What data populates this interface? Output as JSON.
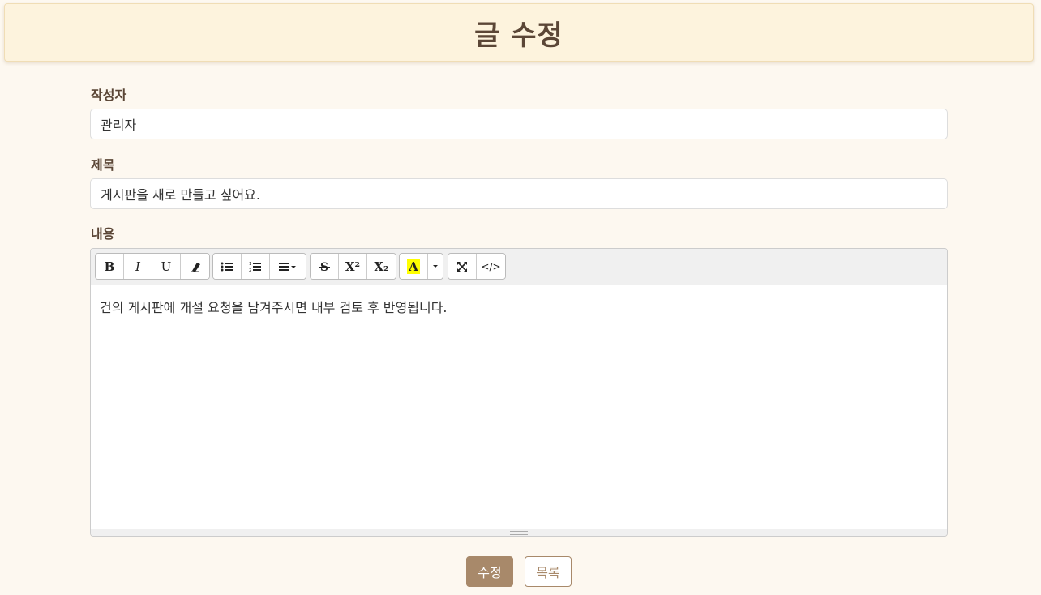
{
  "header": {
    "title": "글 수정"
  },
  "form": {
    "author_label": "작성자",
    "author_value": "관리자",
    "title_label": "제목",
    "title_value": "게시판을 새로 만들고 싶어요.",
    "content_label": "내용",
    "content_value": "건의 게시판에 개설 요청을 남겨주시면 내부 검토 후 반영됩니다."
  },
  "toolbar": {
    "bold": "B",
    "italic": "I",
    "underline": "U",
    "superscript": "X²",
    "subscript": "X₂",
    "color": "A",
    "code": "</>"
  },
  "buttons": {
    "submit": "수정",
    "list": "목록"
  },
  "colors": {
    "accent": "#a8896a",
    "header_bg": "#fdf3dd",
    "title": "#5b4636"
  }
}
